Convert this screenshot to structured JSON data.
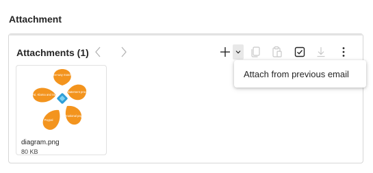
{
  "section": {
    "title": "Attachment"
  },
  "attachments": {
    "title": "Attachments (1)",
    "toolbar": {
      "prev_icon": "chevron-left-icon",
      "next_icon": "chevron-right-icon",
      "add_icon": "plus-icon",
      "dropdown_icon": "chevron-down-icon",
      "copy_icon": "copy-icon",
      "paste_icon": "clipboard-icon",
      "select_icon": "checkbox-icon",
      "download_icon": "download-icon",
      "more_icon": "more-vertical-icon"
    },
    "files": [
      {
        "name": "diagram.png",
        "size": "80 KB",
        "thumbnail": {
          "petals": [
            "Three-way matching",
            "Bank statement processing",
            "International payments",
            "Paypal",
            "PayPal, Klarna and Stripe"
          ],
          "colors": {
            "petal": "#f3941e",
            "center": "#2f9fd8"
          }
        }
      }
    ]
  },
  "tooltip": {
    "text": "Attach from previous email"
  },
  "colors": {
    "border": "#d6d6d6",
    "text": "#242424",
    "icon_disabled": "#c8c8c8"
  }
}
